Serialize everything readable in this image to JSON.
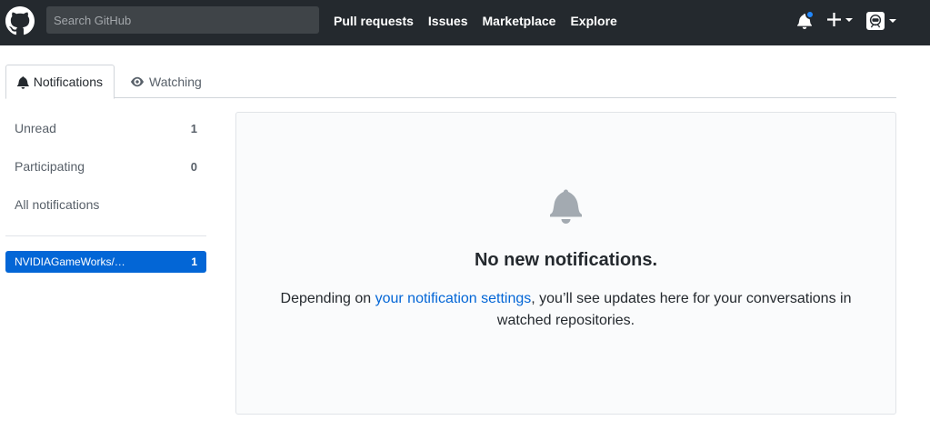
{
  "header": {
    "logo_icon": "github-mark-icon",
    "search_placeholder": "Search GitHub",
    "nav": [
      "Pull requests",
      "Issues",
      "Marketplace",
      "Explore"
    ],
    "notification_icon": "bell-icon",
    "create_icon": "plus-icon",
    "avatar_icon": "avatar-icon",
    "colors": {
      "background": "#24292e",
      "unread_dot": "#2188ff"
    }
  },
  "tabs": {
    "notifications": "Notifications",
    "watching": "Watching"
  },
  "sidebar": {
    "filters": [
      {
        "label": "Unread",
        "count": "1"
      },
      {
        "label": "Participating",
        "count": "0"
      },
      {
        "label": "All notifications",
        "count": ""
      }
    ],
    "repos": [
      {
        "label": "NVIDIAGameWorks/…",
        "count": "1",
        "selected": true
      }
    ]
  },
  "main": {
    "icon": "bell-icon",
    "title": "No new notifications.",
    "text_before": "Depending on ",
    "link_text": "your notification settings",
    "text_after": ", you’ll see updates here for your conversations in watched repositories."
  },
  "colors": {
    "accent": "#0366d6"
  }
}
